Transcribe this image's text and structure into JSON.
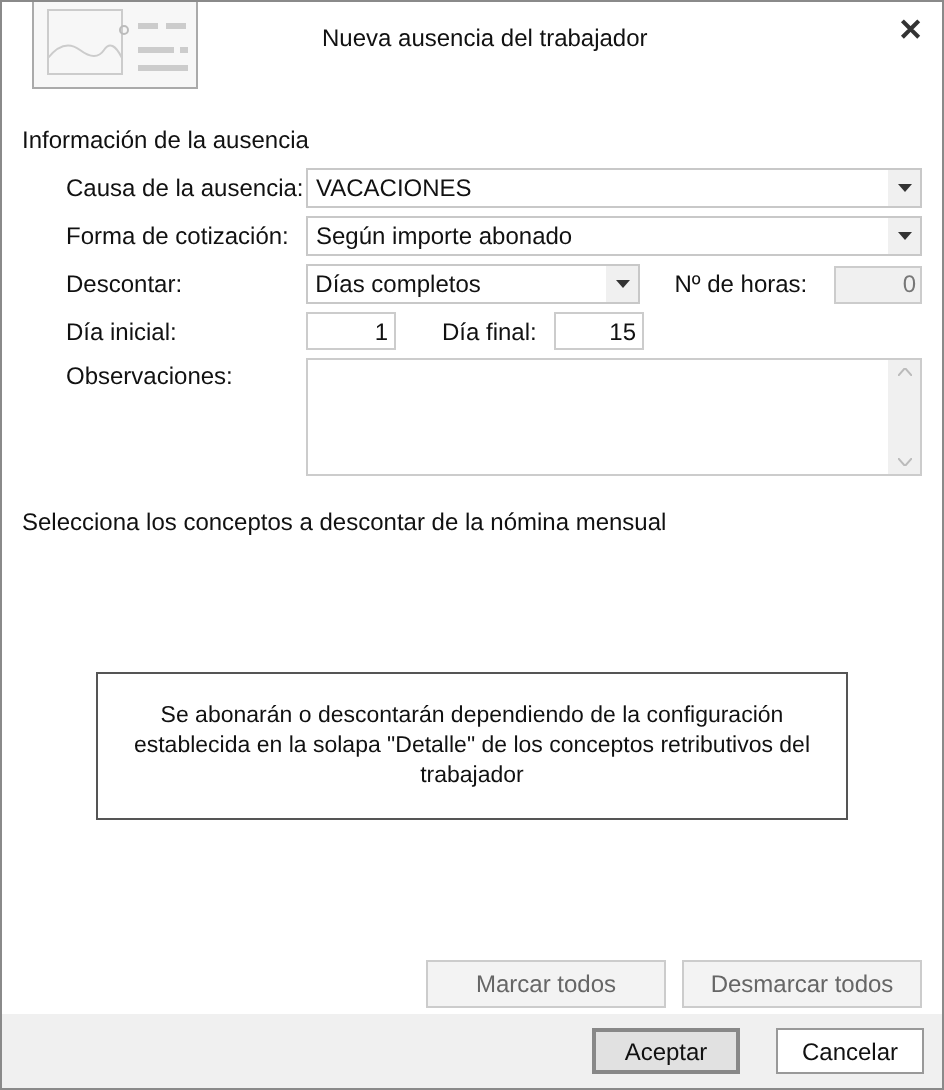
{
  "window": {
    "title": "Nueva ausencia del trabajador",
    "close": "✕"
  },
  "section_title": "Información de la ausencia",
  "causa": {
    "label": "Causa de la ausencia:",
    "value": "VACACIONES"
  },
  "forma": {
    "label": "Forma de cotización:",
    "value": "Según importe abonado"
  },
  "descontar": {
    "label": "Descontar:",
    "value": "Días completos"
  },
  "horas": {
    "label": "Nº de horas:",
    "value": "0",
    "disabled": true
  },
  "dia_inicial": {
    "label": "Día inicial:",
    "value": "1"
  },
  "dia_final": {
    "label": "Día final:",
    "value": "15"
  },
  "observaciones": {
    "label": "Observaciones:"
  },
  "conceptos_title": "Selecciona los conceptos a descontar de la nómina mensual",
  "info": "Se abonarán o descontarán dependiendo de la configuración establecida en la solapa \"Detalle\" de los conceptos retributivos del trabajador",
  "select_buttons": [
    {
      "label": "Marcar todos",
      "disabled": true
    },
    {
      "label": "Desmarcar todos",
      "disabled": true
    }
  ],
  "footer_buttons": [
    {
      "label": "Aceptar",
      "selected": true
    },
    {
      "label": "Cancelar",
      "selected": false
    }
  ]
}
